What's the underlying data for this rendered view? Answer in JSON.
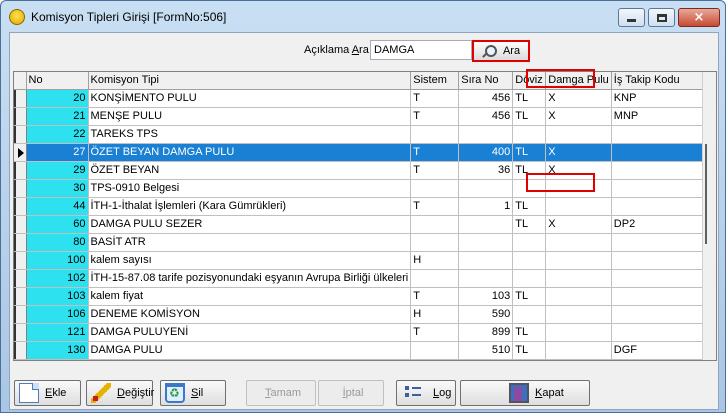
{
  "window": {
    "title": "Komisyon Tipleri Girişi [FormNo:506]",
    "minimize": "minimize",
    "maximize": "maximize",
    "close": "×"
  },
  "search": {
    "label_prefix": "Açıklama ",
    "label_accel": "A",
    "label_suffix": "ra",
    "value": "DAMGA",
    "button_label": "Ara"
  },
  "grid": {
    "columns": [
      "No",
      "Komisyon Tipi",
      "Sistem",
      "Sıra No",
      "Döviz",
      "Damga Pulu",
      "İş Takip Kodu"
    ],
    "selected_row_index": 3,
    "rows": [
      {
        "no": "20",
        "tip": "KONŞİMENTO PULU",
        "sistem": "T",
        "sira": "456",
        "doviz": "TL",
        "damga": "X",
        "is_takip": "KNP"
      },
      {
        "no": "21",
        "tip": "MENŞE PULU",
        "sistem": "T",
        "sira": "456",
        "doviz": "TL",
        "damga": "X",
        "is_takip": "MNP"
      },
      {
        "no": "22",
        "tip": "TAREKS TPS",
        "sistem": "",
        "sira": "",
        "doviz": "",
        "damga": "",
        "is_takip": ""
      },
      {
        "no": "27",
        "tip": "ÖZET BEYAN DAMGA PULU",
        "sistem": "T",
        "sira": "400",
        "doviz": "TL",
        "damga": "X",
        "is_takip": ""
      },
      {
        "no": "29",
        "tip": "ÖZET BEYAN",
        "sistem": "T",
        "sira": "36",
        "doviz": "TL",
        "damga": "X",
        "is_takip": ""
      },
      {
        "no": "30",
        "tip": "TPS-0910 Belgesi",
        "sistem": "",
        "sira": "",
        "doviz": "",
        "damga": "",
        "is_takip": ""
      },
      {
        "no": "44",
        "tip": "İTH-1-İthalat İşlemleri  (Kara Gümrükleri)",
        "sistem": "T",
        "sira": "1",
        "doviz": "TL",
        "damga": "",
        "is_takip": ""
      },
      {
        "no": "60",
        "tip": "DAMGA PULU SEZER",
        "sistem": "",
        "sira": "",
        "doviz": "TL",
        "damga": "X",
        "is_takip": "DP2"
      },
      {
        "no": "80",
        "tip": "BASİT ATR",
        "sistem": "",
        "sira": "",
        "doviz": "",
        "damga": "",
        "is_takip": ""
      },
      {
        "no": "100",
        "tip": "kalem sayısı",
        "sistem": "H",
        "sira": "",
        "doviz": "",
        "damga": "",
        "is_takip": ""
      },
      {
        "no": "102",
        "tip": "İTH-15-87.08 tarife pozisyonundaki eşyanın Avrupa Birliği ülkeleri",
        "sistem": "",
        "sira": "",
        "doviz": "",
        "damga": "",
        "is_takip": ""
      },
      {
        "no": "103",
        "tip": "kalem fiyat",
        "sistem": "T",
        "sira": "103",
        "doviz": "TL",
        "damga": "",
        "is_takip": ""
      },
      {
        "no": "106",
        "tip": "DENEME KOMİSYON",
        "sistem": "H",
        "sira": "590",
        "doviz": "",
        "damga": "",
        "is_takip": ""
      },
      {
        "no": "121",
        "tip": "DAMGA PULUYENİ",
        "sistem": "T",
        "sira": "899",
        "doviz": "TL",
        "damga": "",
        "is_takip": ""
      },
      {
        "no": "130",
        "tip": "DAMGA PULU",
        "sistem": "",
        "sira": "510",
        "doviz": "TL",
        "damga": "",
        "is_takip": "DGF"
      }
    ]
  },
  "toolbar": {
    "ekle": {
      "accel": "E",
      "rest": "kle"
    },
    "degistir": {
      "accel": "D",
      "rest": "eğiştir"
    },
    "sil": {
      "accel": "S",
      "rest": "il"
    },
    "tamam": {
      "accel": "T",
      "rest": "amam"
    },
    "iptal": {
      "accel": "İ",
      "rest": "ptal"
    },
    "log": {
      "accel": "L",
      "rest": "og"
    },
    "kapat": {
      "accel": "K",
      "rest": "apat"
    }
  },
  "colors": {
    "selection": "#1a80d4",
    "no_column": "#2de2ee",
    "highlight_box": "#e00000"
  }
}
